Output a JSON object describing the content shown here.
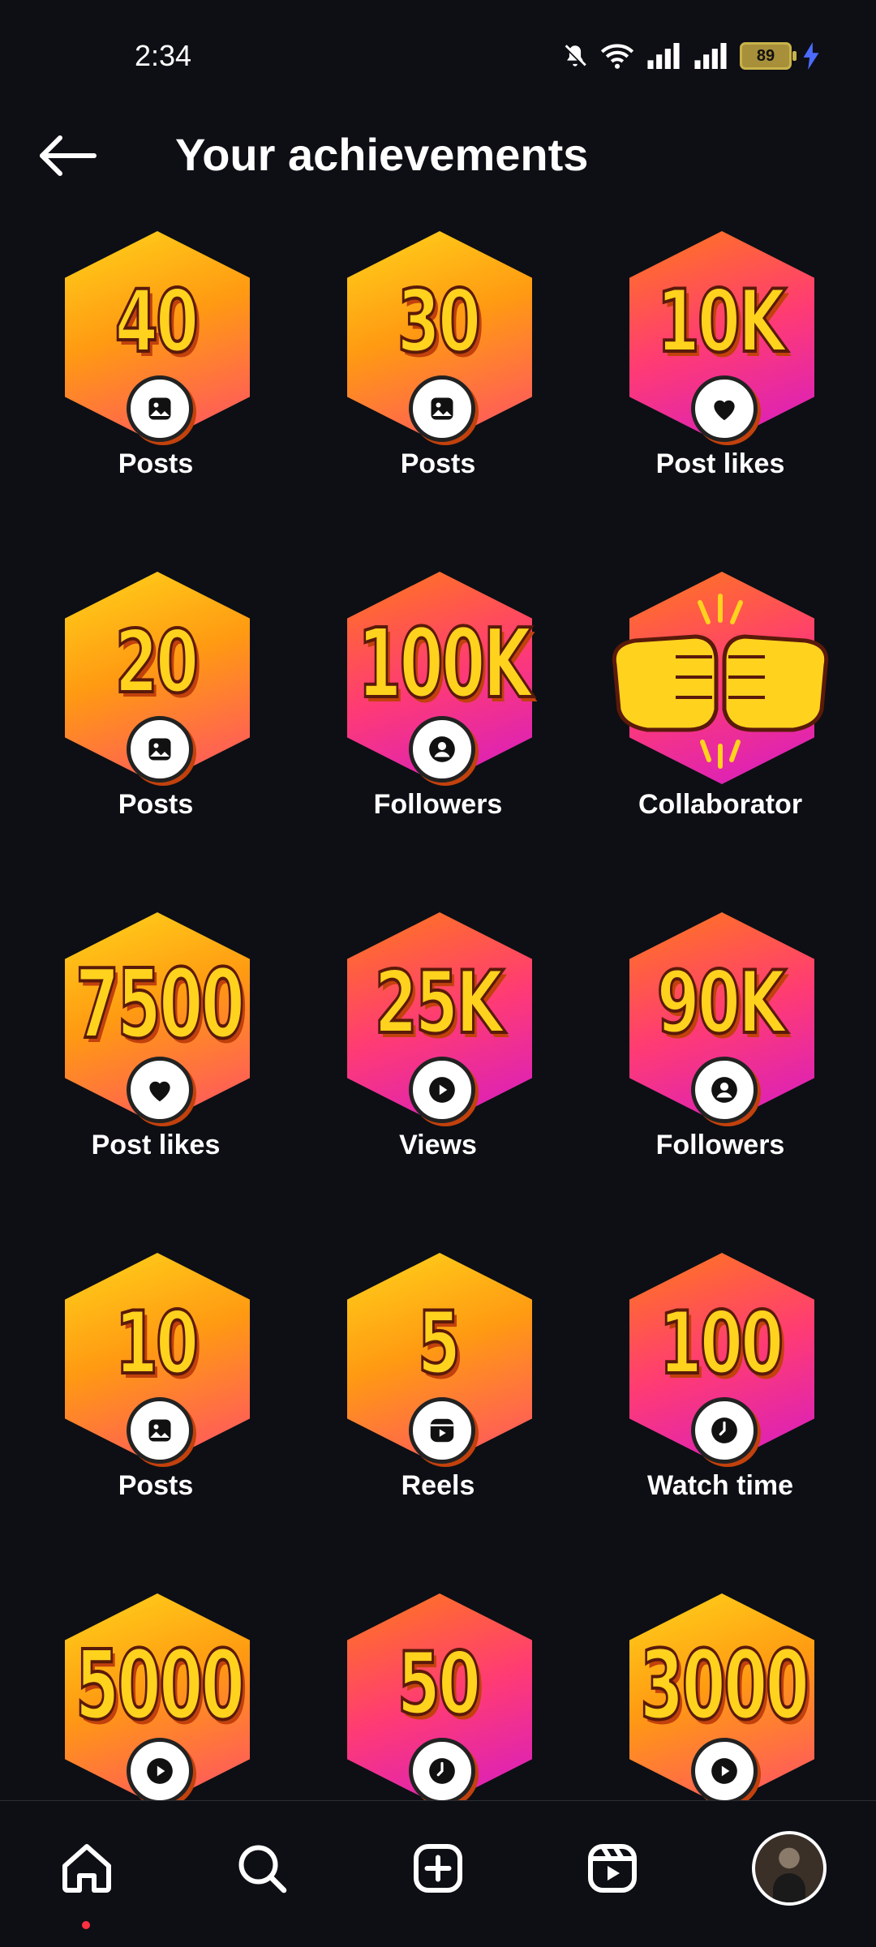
{
  "status_bar": {
    "time": "2:34",
    "battery": "89"
  },
  "header": {
    "title": "Your achievements"
  },
  "badges": [
    {
      "value": "40",
      "label": "Posts",
      "icon": "image-icon"
    },
    {
      "value": "30",
      "label": "Posts",
      "icon": "image-icon"
    },
    {
      "value": "10K",
      "label": "Post likes",
      "icon": "heart-icon"
    },
    {
      "value": "20",
      "label": "Posts",
      "icon": "image-icon"
    },
    {
      "value": "100K",
      "label": "Followers",
      "icon": "person-icon"
    },
    {
      "value": "",
      "label": "Collaborator",
      "icon": "fist-bump-icon"
    },
    {
      "value": "7500",
      "label": "Post likes",
      "icon": "heart-icon"
    },
    {
      "value": "25K",
      "label": "Views",
      "icon": "play-icon"
    },
    {
      "value": "90K",
      "label": "Followers",
      "icon": "person-icon"
    },
    {
      "value": "10",
      "label": "Posts",
      "icon": "image-icon"
    },
    {
      "value": "5",
      "label": "Reels",
      "icon": "reels-icon"
    },
    {
      "value": "100",
      "label": "Watch time",
      "icon": "clock-icon"
    },
    {
      "value": "5000",
      "label": "",
      "icon": "play-icon"
    },
    {
      "value": "50",
      "label": "",
      "icon": "clock-icon"
    },
    {
      "value": "3000",
      "label": "",
      "icon": "play-icon"
    }
  ],
  "nav": {
    "items": [
      "home-icon",
      "search-icon",
      "create-icon",
      "reels-icon",
      "profile-avatar"
    ],
    "active": "home-icon"
  },
  "colors": {
    "background": "#0d0f14",
    "badge_yellow": "#ffd21e",
    "badge_pink": "#d41bc7",
    "notification_dot": "#ff3040"
  }
}
